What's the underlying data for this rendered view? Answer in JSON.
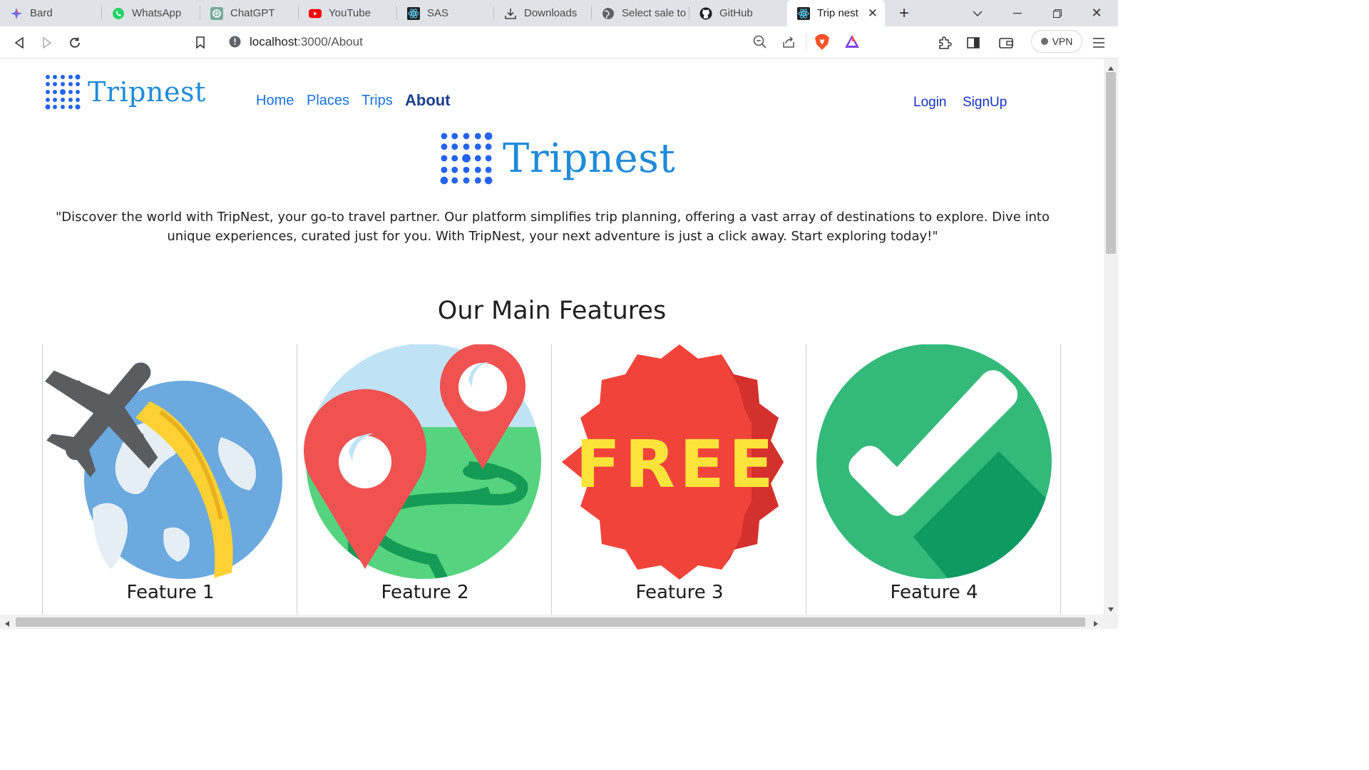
{
  "browser": {
    "tabs": [
      {
        "label": "Bard",
        "icon": "bard-icon"
      },
      {
        "label": "WhatsApp",
        "icon": "whatsapp-icon"
      },
      {
        "label": "ChatGPT",
        "icon": "chatgpt-icon"
      },
      {
        "label": "YouTube",
        "icon": "youtube-icon"
      },
      {
        "label": "SAS",
        "icon": "react-icon"
      },
      {
        "label": "Downloads",
        "icon": "download-icon"
      },
      {
        "label": "Select sale to d",
        "icon": "globe-icon"
      },
      {
        "label": "GitHub",
        "icon": "github-icon"
      },
      {
        "label": "Trip nest",
        "icon": "react-icon",
        "active": true
      }
    ],
    "url_host": "localhost",
    "url_path": ":3000/About",
    "vpn_label": "VPN"
  },
  "site": {
    "brand": "Tripnest",
    "nav": [
      {
        "label": "Home"
      },
      {
        "label": "Places"
      },
      {
        "label": "Trips"
      },
      {
        "label": "About",
        "active": true
      }
    ],
    "login_label": "Login",
    "signup_label": "SignUp"
  },
  "about": {
    "hero_brand": "Tripnest",
    "intro": "\"Discover the world with TripNest, your go-to travel partner. Our platform simplifies trip planning, offering a vast array of destinations to explore. Dive into unique experiences, curated just for you. With TripNest, your next adventure is just a click away. Start exploring today!\"",
    "features_title": "Our Main Features",
    "features": [
      {
        "label": "Feature 1",
        "icon": "airplane-globe-icon"
      },
      {
        "label": "Feature 2",
        "icon": "map-pins-icon"
      },
      {
        "label": "Feature 3",
        "icon": "free-badge-icon",
        "badge_text": "FREE"
      },
      {
        "label": "Feature 4",
        "icon": "checkmark-icon"
      }
    ]
  },
  "colors": {
    "brand_blue": "#1f8bd8",
    "nav_blue": "#1a73e8",
    "pin_red": "#f05252",
    "check_green": "#33b97a",
    "badge_red": "#f0443a",
    "badge_yellow": "#fce33a"
  }
}
